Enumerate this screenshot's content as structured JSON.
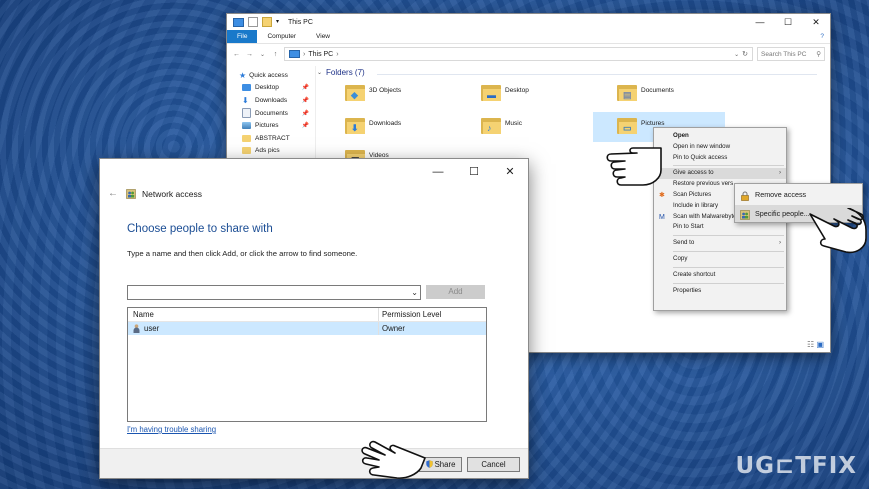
{
  "explorer": {
    "title": "This PC",
    "window_controls": [
      "—",
      "☐",
      "✕"
    ],
    "ribbon_tabs": [
      "File",
      "Computer",
      "View"
    ],
    "help": "?",
    "breadcrumb": [
      "This PC",
      "›"
    ],
    "search_placeholder": "Search This PC",
    "sidebar": [
      {
        "label": "Quick access",
        "icon": "star-icon",
        "pinned": false
      },
      {
        "label": "Desktop",
        "icon": "desktop-icon",
        "pinned": true
      },
      {
        "label": "Downloads",
        "icon": "download-icon",
        "pinned": true
      },
      {
        "label": "Documents",
        "icon": "documents-icon",
        "pinned": true
      },
      {
        "label": "Pictures",
        "icon": "pictures-icon",
        "pinned": true
      },
      {
        "label": "ABSTRACT",
        "icon": "folder-icon",
        "pinned": false
      },
      {
        "label": "Ads pics",
        "icon": "folder-icon",
        "pinned": false
      }
    ],
    "group_header": "Folders (7)",
    "folders": [
      {
        "label": "3D Objects",
        "icon": "3d-objects-icon"
      },
      {
        "label": "Desktop",
        "icon": "desktop-folder-icon"
      },
      {
        "label": "Documents",
        "icon": "documents-folder-icon"
      },
      {
        "label": "Downloads",
        "icon": "downloads-folder-icon"
      },
      {
        "label": "Music",
        "icon": "music-folder-icon"
      },
      {
        "label": "Pictures",
        "icon": "pictures-folder-icon"
      },
      {
        "label": "Videos",
        "icon": "videos-folder-icon"
      }
    ]
  },
  "context_menu": {
    "items": [
      {
        "label": "Open",
        "bold": true
      },
      {
        "label": "Open in new window"
      },
      {
        "label": "Pin to Quick access"
      },
      {
        "sep": true
      },
      {
        "label": "Give access to",
        "submenu": true,
        "highlight": true
      },
      {
        "label": "Restore previous vers"
      },
      {
        "label": "Scan Pictures",
        "icon": "scan-icon"
      },
      {
        "label": "Include in library"
      },
      {
        "label": "Scan with Malwarebytes",
        "icon": "malwarebytes-icon"
      },
      {
        "label": "Pin to Start"
      },
      {
        "sep": true
      },
      {
        "label": "Send to",
        "submenu": true
      },
      {
        "sep": true
      },
      {
        "label": "Copy"
      },
      {
        "sep": true
      },
      {
        "label": "Create shortcut"
      },
      {
        "sep": true
      },
      {
        "label": "Properties"
      }
    ],
    "submenu": [
      {
        "label": "Remove access",
        "icon": "lock-icon"
      },
      {
        "label": "Specific people...",
        "icon": "people-icon",
        "highlight": true
      }
    ]
  },
  "dialog": {
    "window_controls": [
      "—",
      "☐",
      "✕"
    ],
    "back": "←",
    "title": "Network access",
    "heading": "Choose people to share with",
    "instruction": "Type a name and then click Add, or click the arrow to find someone.",
    "input_value": "",
    "dropdown_glyph": "⌄",
    "add_button": "Add",
    "table_headers": [
      "Name",
      "Permission Level"
    ],
    "rows": [
      {
        "name": "user",
        "permission": "Owner"
      }
    ],
    "trouble_link": "I'm having trouble sharing",
    "share_button": "Share",
    "cancel_button": "Cancel"
  },
  "watermark": "UG⊏TFIX",
  "colors": {
    "accent_blue": "#1979ca",
    "heading_blue": "#1b4d94",
    "selection": "#cce8ff",
    "folder_yellow": "#f5d272"
  }
}
